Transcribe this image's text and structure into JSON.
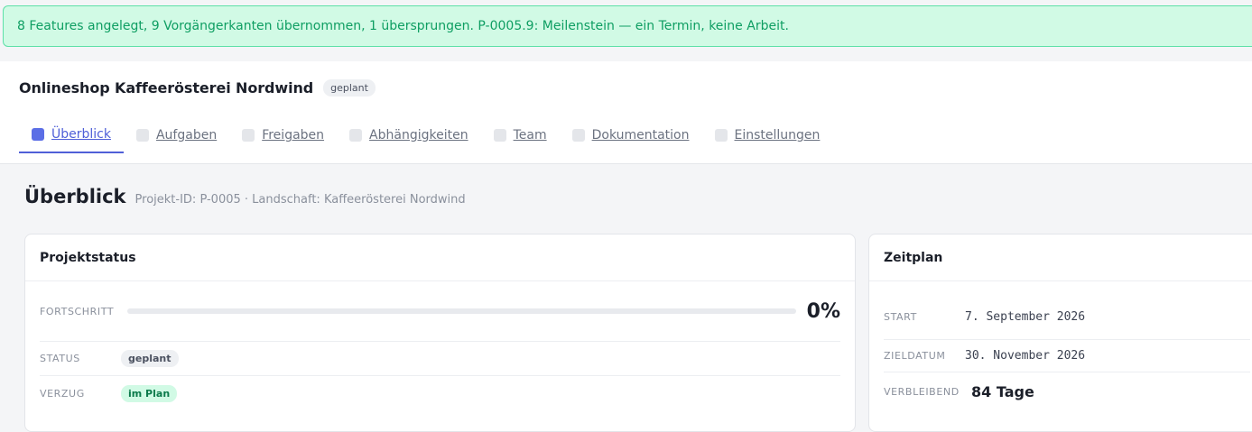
{
  "toast": {
    "message": "8 Features angelegt, 9 Vorgängerkanten übernommen, 1 übersprungen. P-0005.9: Meilenstein — ein Termin, keine Arbeit."
  },
  "project": {
    "title": "Onlineshop Kaffeerösterei Nordwind",
    "status_badge": "geplant"
  },
  "tabs": [
    {
      "label": "Überblick",
      "active": true
    },
    {
      "label": "Aufgaben",
      "active": false
    },
    {
      "label": "Freigaben",
      "active": false
    },
    {
      "label": "Abhängigkeiten",
      "active": false
    },
    {
      "label": "Team",
      "active": false
    },
    {
      "label": "Dokumentation",
      "active": false
    },
    {
      "label": "Einstellungen",
      "active": false
    }
  ],
  "overview": {
    "title": "Überblick",
    "meta": "Projekt-ID: P-0005 · Landschaft: Kaffeerösterei Nordwind"
  },
  "status_card": {
    "title": "Projektstatus",
    "progress_label": "FORTSCHRITT",
    "progress_fraction": 0,
    "progress_text": "0%",
    "status_label": "STATUS",
    "status_value": "geplant",
    "delay_label": "VERZUG",
    "delay_value": "im Plan"
  },
  "plan_card": {
    "title": "Zeitplan",
    "start_label": "START",
    "start_value": "7. September 2026",
    "target_label": "ZIELDATUM",
    "target_value": "30. November 2026",
    "remaining_label": "VERBLEIBEND",
    "remaining_value": "84 Tage"
  },
  "colors": {
    "accent": "#5b6ee6",
    "success_bg": "#d1fae5",
    "success_text": "#0e9e62"
  }
}
